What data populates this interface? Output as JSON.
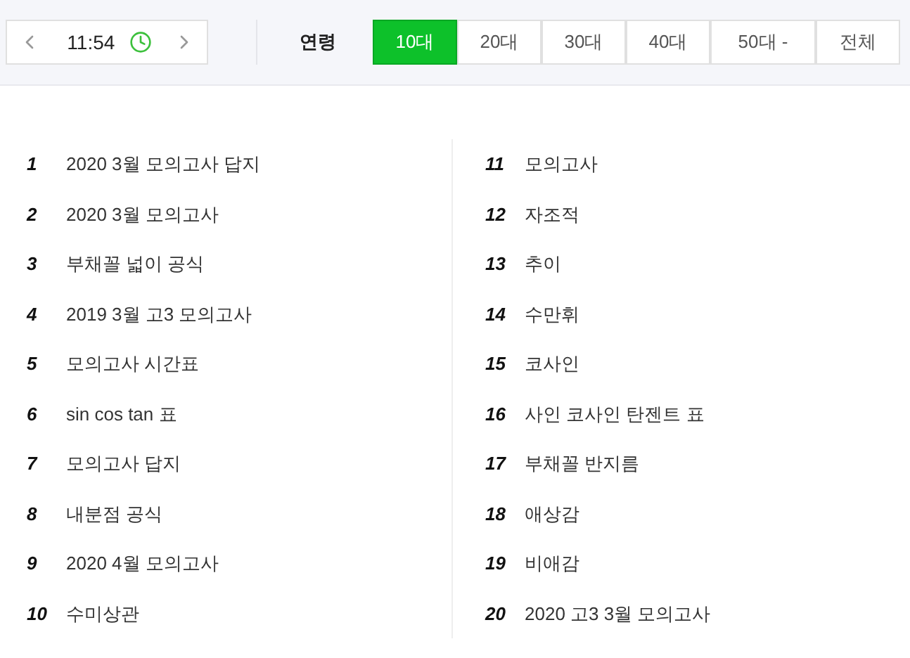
{
  "time_nav": {
    "time": "11:54"
  },
  "age_filter": {
    "label": "연령",
    "tabs": [
      {
        "label": "10대",
        "selected": true
      },
      {
        "label": "20대",
        "selected": false
      },
      {
        "label": "30대",
        "selected": false
      },
      {
        "label": "40대",
        "selected": false
      },
      {
        "label": "50대 -",
        "selected": false
      },
      {
        "label": "전체",
        "selected": false
      }
    ]
  },
  "columns": [
    [
      {
        "rank": "1",
        "keyword": "2020 3월 모의고사 답지"
      },
      {
        "rank": "2",
        "keyword": "2020 3월 모의고사"
      },
      {
        "rank": "3",
        "keyword": "부채꼴 넓이 공식"
      },
      {
        "rank": "4",
        "keyword": "2019 3월 고3 모의고사"
      },
      {
        "rank": "5",
        "keyword": "모의고사 시간표"
      },
      {
        "rank": "6",
        "keyword": "sin cos tan 표"
      },
      {
        "rank": "7",
        "keyword": "모의고사 답지"
      },
      {
        "rank": "8",
        "keyword": "내분점 공식"
      },
      {
        "rank": "9",
        "keyword": "2020 4월 모의고사"
      },
      {
        "rank": "10",
        "keyword": "수미상관"
      }
    ],
    [
      {
        "rank": "11",
        "keyword": "모의고사"
      },
      {
        "rank": "12",
        "keyword": "자조적"
      },
      {
        "rank": "13",
        "keyword": "추이"
      },
      {
        "rank": "14",
        "keyword": "수만휘"
      },
      {
        "rank": "15",
        "keyword": "코사인"
      },
      {
        "rank": "16",
        "keyword": "사인 코사인 탄젠트 표"
      },
      {
        "rank": "17",
        "keyword": "부채꼴 반지름"
      },
      {
        "rank": "18",
        "keyword": "애상감"
      },
      {
        "rank": "19",
        "keyword": "비애감"
      },
      {
        "rank": "20",
        "keyword": "2020 고3 3월 모의고사"
      }
    ]
  ]
}
